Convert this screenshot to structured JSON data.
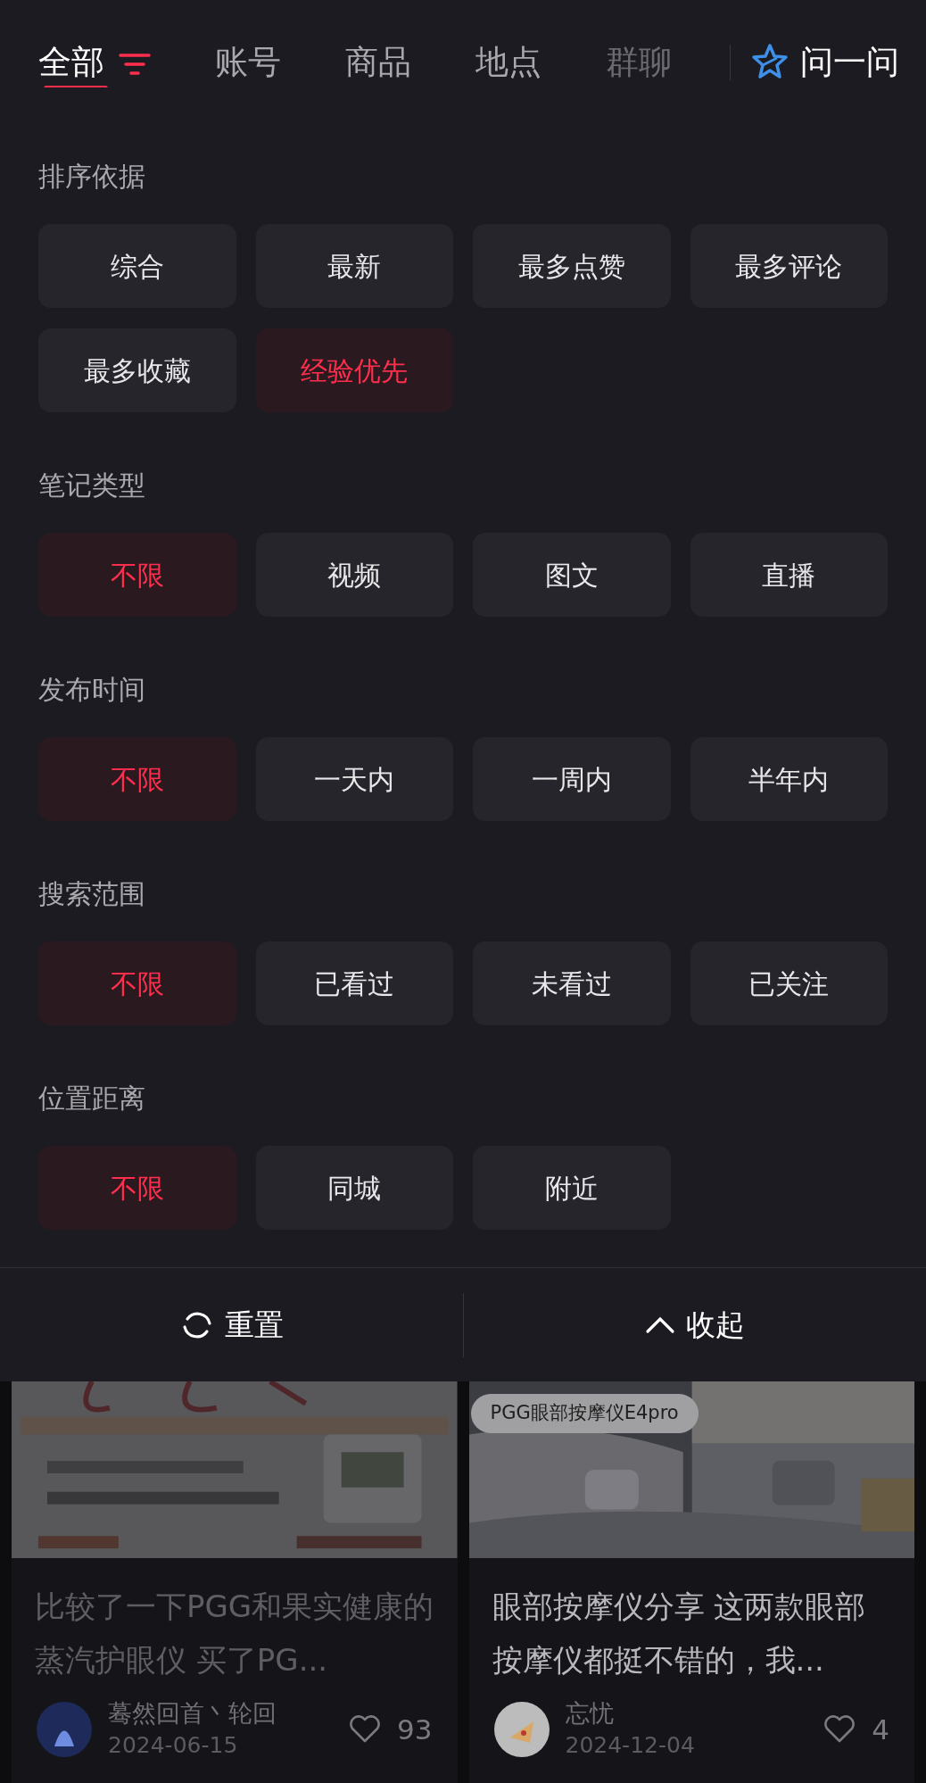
{
  "tabs": [
    {
      "label": "全部",
      "selected": true
    },
    {
      "label": "账号",
      "selected": false
    },
    {
      "label": "商品",
      "selected": false
    },
    {
      "label": "地点",
      "selected": false
    },
    {
      "label": "群聊",
      "selected": false
    }
  ],
  "ask_button": {
    "label": "问一问"
  },
  "filter_groups": [
    {
      "title": "排序依据",
      "options": [
        {
          "label": "综合",
          "selected": false
        },
        {
          "label": "最新",
          "selected": false
        },
        {
          "label": "最多点赞",
          "selected": false
        },
        {
          "label": "最多评论",
          "selected": false
        },
        {
          "label": "最多收藏",
          "selected": false
        },
        {
          "label": "经验优先",
          "selected": true
        }
      ]
    },
    {
      "title": "笔记类型",
      "options": [
        {
          "label": "不限",
          "selected": true
        },
        {
          "label": "视频",
          "selected": false
        },
        {
          "label": "图文",
          "selected": false
        },
        {
          "label": "直播",
          "selected": false
        }
      ]
    },
    {
      "title": "发布时间",
      "options": [
        {
          "label": "不限",
          "selected": true
        },
        {
          "label": "一天内",
          "selected": false
        },
        {
          "label": "一周内",
          "selected": false
        },
        {
          "label": "半年内",
          "selected": false
        }
      ]
    },
    {
      "title": "搜索范围",
      "options": [
        {
          "label": "不限",
          "selected": true
        },
        {
          "label": "已看过",
          "selected": false
        },
        {
          "label": "未看过",
          "selected": false
        },
        {
          "label": "已关注",
          "selected": false
        }
      ]
    },
    {
      "title": "位置距离",
      "options": [
        {
          "label": "不限",
          "selected": true
        },
        {
          "label": "同城",
          "selected": false
        },
        {
          "label": "附近",
          "selected": false
        }
      ]
    }
  ],
  "footer_buttons": [
    {
      "kind": "reset",
      "label": "重置"
    },
    {
      "kind": "collapse",
      "label": "收起"
    }
  ],
  "notes": [
    {
      "title": "比较了一下PGG和果实健康的蒸汽护眼仪 买了PG...",
      "dimmed": true,
      "author": "蓦然回首丶轮回",
      "date": "2024-06-15",
      "likes": "93"
    },
    {
      "image": {
        "kind": "picture",
        "tag": "PGG眼部按摩仪E4pro"
      },
      "title": "眼部按摩仪分享 这两款眼部按摩仪都挺不错的，我...",
      "dimmed": false,
      "author": "忘忧",
      "date": "2024-12-04",
      "likes": "4"
    }
  ]
}
